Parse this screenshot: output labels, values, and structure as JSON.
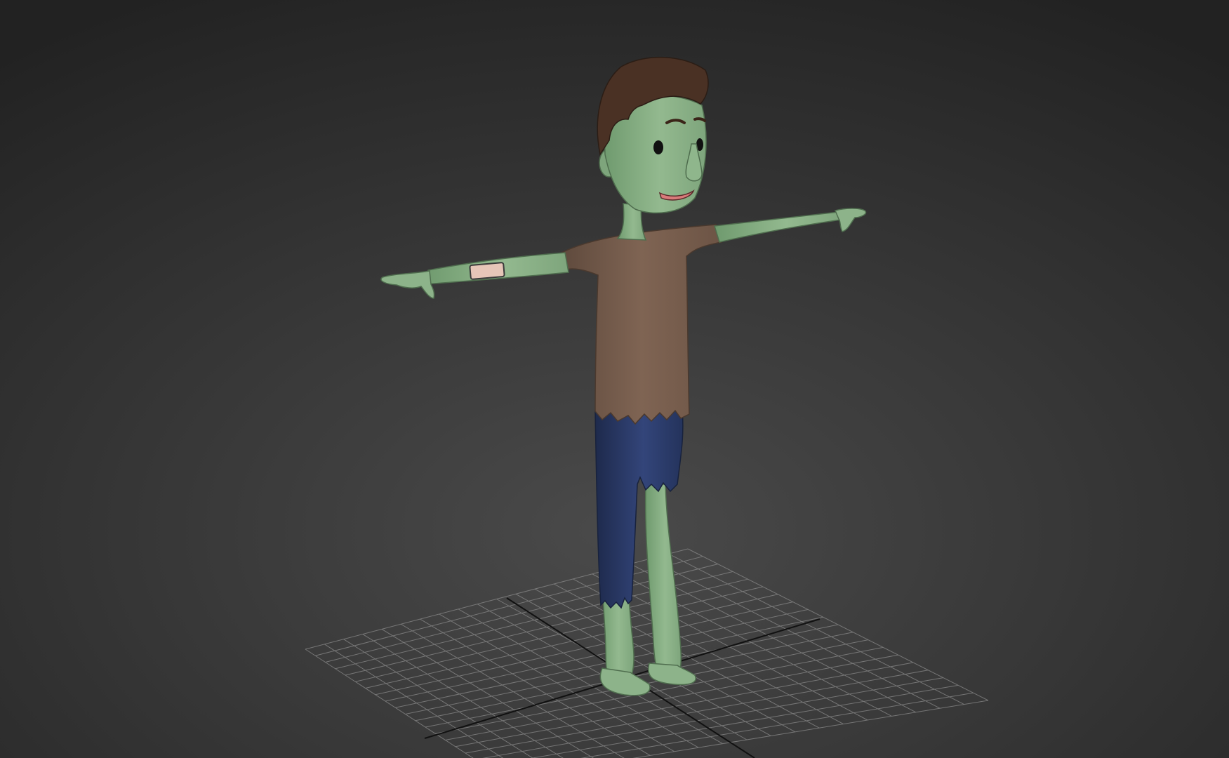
{
  "viewport": {
    "background_top": "#222222",
    "background_bottom": "#4a4a4a",
    "grid_color": "#8a8a8a",
    "axis_color": "#111111"
  },
  "character": {
    "skin_color": "#8db38a",
    "skin_shadow": "#6f9a6e",
    "hair_color": "#4a3124",
    "shirt_color": "#7b6150",
    "shirt_shadow": "#5f4a3d",
    "pants_color": "#2b3a66",
    "pants_shadow": "#1e2a4c",
    "eye_color": "#111111",
    "mouth_color": "#d97a7a",
    "bandage_color": "#e6c6b8",
    "icons": {
      "head": "character-head-icon",
      "torso": "character-torso-icon",
      "legs": "character-legs-icon"
    }
  }
}
